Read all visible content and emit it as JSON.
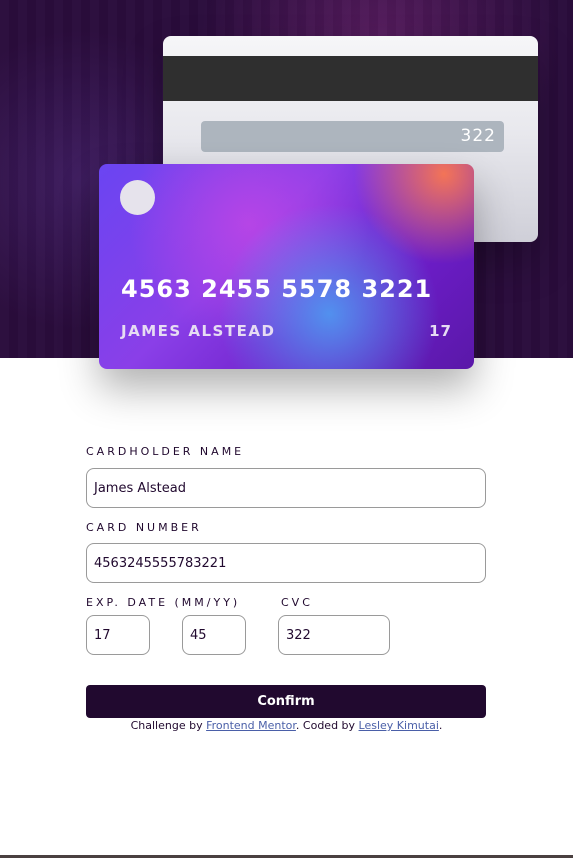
{
  "card": {
    "back_cvc": "322",
    "number": "4563 2455 5578 3221",
    "holder": "JAMES ALSTEAD",
    "exp": "17"
  },
  "form": {
    "name_label": "CARDHOLDER NAME",
    "name_value": "James Alstead",
    "number_label": "CARD NUMBER",
    "number_value": "4563245555783221",
    "exp_label": "EXP. DATE (MM/YY)",
    "exp_mm": "17",
    "exp_yy": "45",
    "cvc_label": "CVC",
    "cvc_value": "322",
    "confirm_label": "Confirm"
  },
  "attribution": {
    "prefix": "Challenge by ",
    "link1": "Frontend Mentor",
    "mid": ". Coded by ",
    "link2": "Lesley Kimutai",
    "suffix": "."
  },
  "colors": {
    "dark_violet": "#21092f",
    "hero_bg": "#2a0c3c",
    "link": "#4a5fa8"
  }
}
